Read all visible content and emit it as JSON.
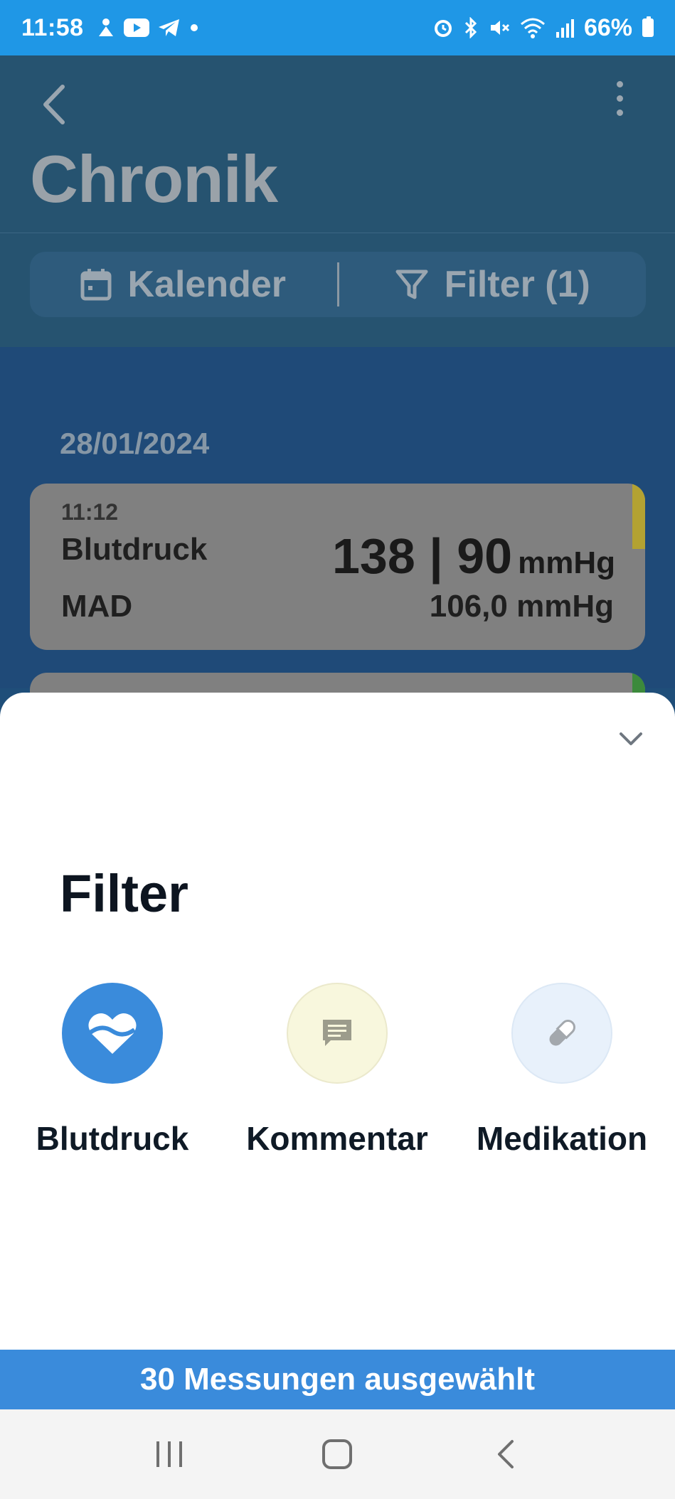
{
  "status_bar": {
    "time": "11:58",
    "battery": "66%",
    "left_icons": [
      "app-icon",
      "youtube-icon",
      "telegram-icon",
      "dot-icon"
    ],
    "right_icons": [
      "alarm-icon",
      "bluetooth-icon",
      "mute-icon",
      "wifi-icon",
      "signal-icon",
      "battery-icon"
    ]
  },
  "header": {
    "title": "Chronik",
    "back_icon": "chevron-left-icon",
    "more_icon": "more-vertical-icon"
  },
  "toolbar": {
    "calendar_label": "Kalender",
    "filter_label": "Filter (1)"
  },
  "list": {
    "date": "28/01/2024",
    "entries": [
      {
        "time": "11:12",
        "type": "Blutdruck",
        "value": "138 | 90",
        "unit": "mmHg",
        "secondary_label": "MAD",
        "secondary_value": "106,0 mmHg",
        "accent_color": "#b3a232"
      }
    ]
  },
  "sheet": {
    "title": "Filter",
    "close_icon": "chevron-down-icon",
    "filters": [
      {
        "label": "Blutdruck",
        "icon": "heart-icon",
        "active": true,
        "color": "#3a8bdb"
      },
      {
        "label": "Kommentar",
        "icon": "comment-icon",
        "active": false,
        "color": "#f8f7dd"
      },
      {
        "label": "Medikation",
        "icon": "pill-icon",
        "active": false,
        "color": "#e8f1fb"
      }
    ]
  },
  "selection_bar": {
    "text": "30 Messungen ausgewählt"
  },
  "nav": {
    "icons": [
      "recent-apps-icon",
      "home-icon",
      "back-icon"
    ]
  }
}
